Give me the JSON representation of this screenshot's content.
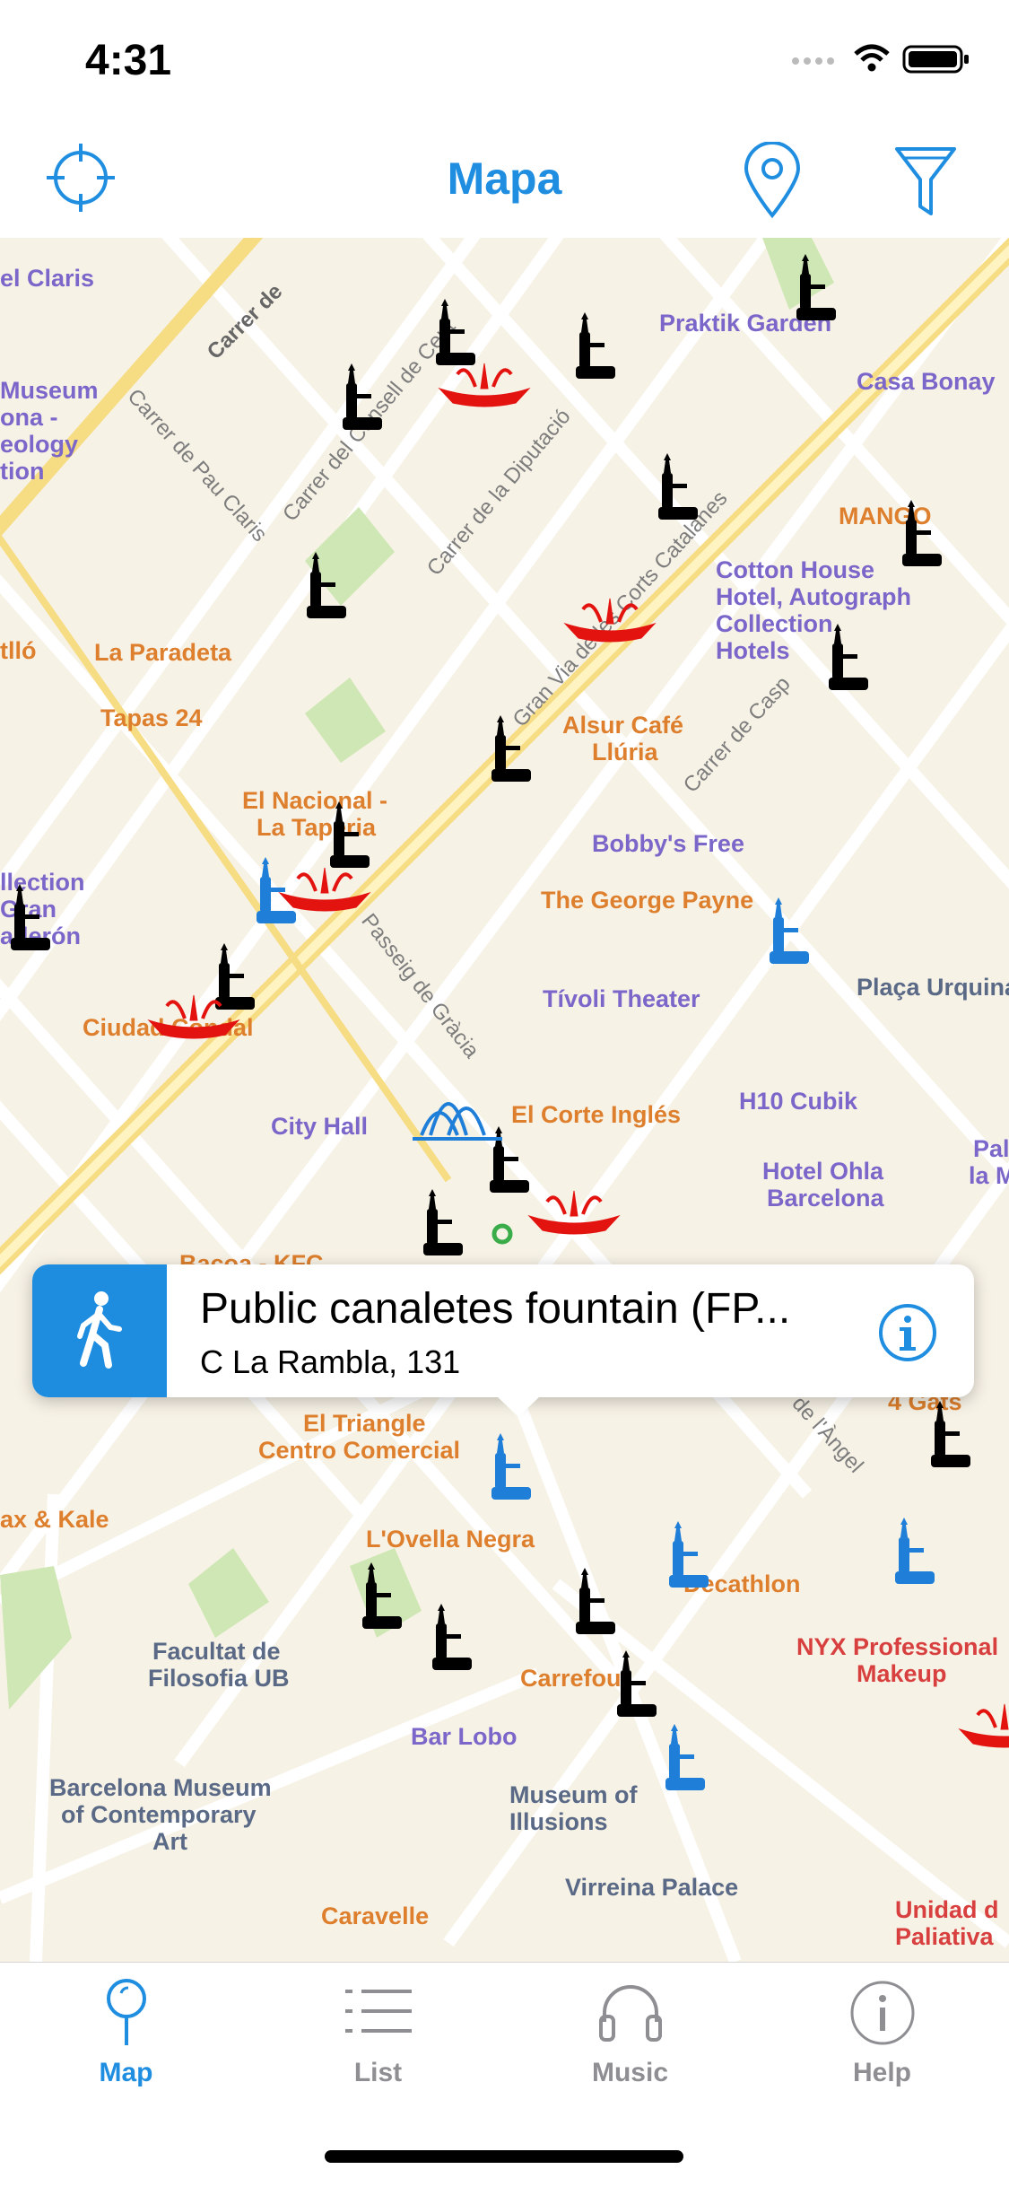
{
  "status": {
    "time": "4:31"
  },
  "nav": {
    "title": "Mapa",
    "locate_icon": "crosshair-icon",
    "pin_icon": "map-pin-icon",
    "filter_icon": "filter-icon"
  },
  "map": {
    "pois": [
      {
        "label": "el Claris",
        "style": "purple"
      },
      {
        "label": "Praktik Garden",
        "style": "purple"
      },
      {
        "label": "Casa Bonay",
        "style": "purple"
      },
      {
        "label": "Museum",
        "style": "purple"
      },
      {
        "label": "ona -",
        "style": "purple"
      },
      {
        "label": "eology",
        "style": "purple"
      },
      {
        "label": "tion",
        "style": "purple"
      },
      {
        "label": "MANGO",
        "style": "orange"
      },
      {
        "label": "Cotton House",
        "style": "purple"
      },
      {
        "label": "Hotel, Autograph",
        "style": "purple"
      },
      {
        "label": "Collection",
        "style": "purple"
      },
      {
        "label": "Hotels",
        "style": "purple"
      },
      {
        "label": "tlló",
        "style": "orange"
      },
      {
        "label": "La Paradeta",
        "style": "orange"
      },
      {
        "label": "Tapas 24",
        "style": "orange"
      },
      {
        "label": "Alsur Café",
        "style": "orange"
      },
      {
        "label": "Llúria",
        "style": "orange"
      },
      {
        "label": "El Nacional -",
        "style": "orange"
      },
      {
        "label": "La Taperia",
        "style": "orange"
      },
      {
        "label": "Bobby's Free",
        "style": "purple"
      },
      {
        "label": "The George Payne",
        "style": "orange"
      },
      {
        "label": "llection",
        "style": "purple"
      },
      {
        "label": "Gran",
        "style": "purple"
      },
      {
        "label": "aderón",
        "style": "purple"
      },
      {
        "label": "Tívoli Theater",
        "style": "purple"
      },
      {
        "label": "Plaça Urquinaona",
        "style": "gray"
      },
      {
        "label": "Ciudad Condal",
        "style": "orange"
      },
      {
        "label": "City Hall",
        "style": "purple"
      },
      {
        "label": "El Corte Inglés",
        "style": "orange"
      },
      {
        "label": "H10 Cubik",
        "style": "purple"
      },
      {
        "label": "Hotel Ohla",
        "style": "purple"
      },
      {
        "label": "Barcelona",
        "style": "purple"
      },
      {
        "label": "Pal",
        "style": "purple"
      },
      {
        "label": "la M",
        "style": "purple"
      },
      {
        "label": "Bacoa - KFC",
        "style": "orange"
      },
      {
        "label": "4 Gats",
        "style": "orange"
      },
      {
        "label": "El Triangle",
        "style": "orange"
      },
      {
        "label": "Centro Comercial",
        "style": "orange"
      },
      {
        "label": "ax & Kale",
        "style": "orange"
      },
      {
        "label": "L'Ovella Negra",
        "style": "orange"
      },
      {
        "label": "Decathlon",
        "style": "orange"
      },
      {
        "label": "Facultat de",
        "style": "gray"
      },
      {
        "label": "Filosofia UB",
        "style": "gray"
      },
      {
        "label": "NYX Professional",
        "style": "red"
      },
      {
        "label": "Makeup",
        "style": "red"
      },
      {
        "label": "Carrefour",
        "style": "orange"
      },
      {
        "label": "Bar Lobo",
        "style": "purple"
      },
      {
        "label": "Barcelona Museum",
        "style": "gray"
      },
      {
        "label": "of Contemporary",
        "style": "gray"
      },
      {
        "label": "Art",
        "style": "gray"
      },
      {
        "label": "Museum of",
        "style": "gray"
      },
      {
        "label": "Illusions",
        "style": "gray"
      },
      {
        "label": "Virreina Palace",
        "style": "gray"
      },
      {
        "label": "Caravelle",
        "style": "orange"
      },
      {
        "label": "Unidad d",
        "style": "red"
      },
      {
        "label": "Paliativa",
        "style": "red"
      }
    ],
    "streets": [
      {
        "label": "Carrer de"
      },
      {
        "label": "Carrer del Consell de Cent"
      },
      {
        "label": "Carrer de Pau Claris"
      },
      {
        "label": "Carrer de la Diputació"
      },
      {
        "label": "Gran Via de les Corts Catalanes"
      },
      {
        "label": "Carrer de Casp"
      },
      {
        "label": "Passeig de Gràcia"
      },
      {
        "label": "de l'Àngel"
      }
    ]
  },
  "callout": {
    "title": "Public canaletes fountain (FP...",
    "address": "C La Rambla, 131",
    "walk_icon": "walking-person-icon",
    "info_icon": "info-icon"
  },
  "tabs": [
    {
      "label": "Map",
      "icon": "map-pin-icon",
      "active": true
    },
    {
      "label": "List",
      "icon": "list-icon",
      "active": false
    },
    {
      "label": "Music",
      "icon": "headphones-icon",
      "active": false
    },
    {
      "label": "Help",
      "icon": "info-icon",
      "active": false
    }
  ],
  "colors": {
    "accent": "#1f8ee0",
    "inactive": "#8e8e93",
    "fountain_black": "#000000",
    "fountain_red": "#e3130f",
    "fountain_blue": "#1e7ed8"
  }
}
